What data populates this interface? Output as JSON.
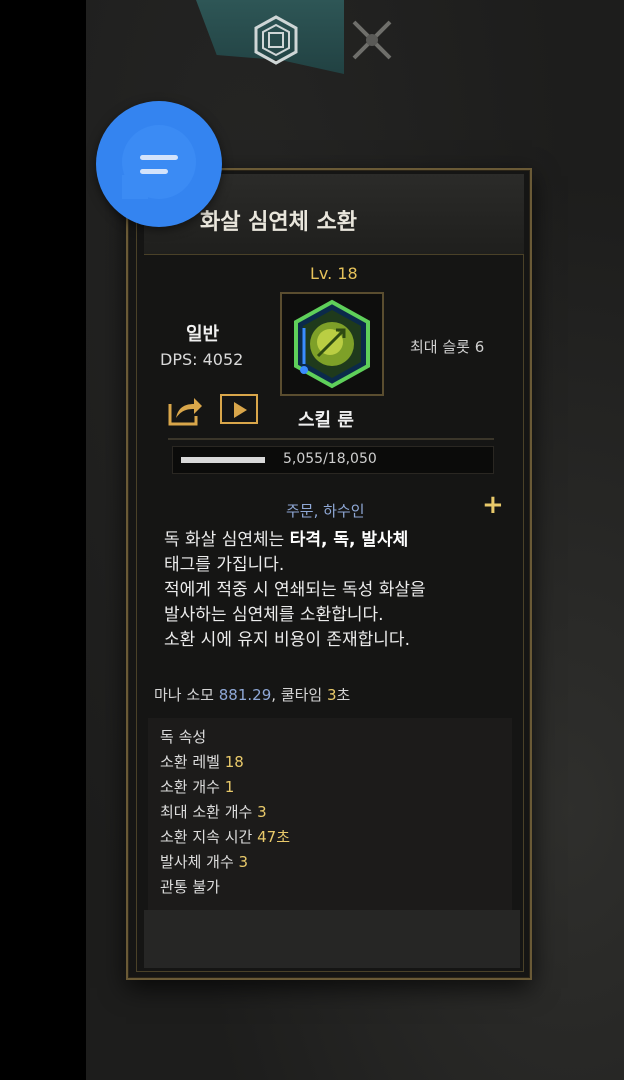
{
  "tabs": [
    {
      "icon": "rune-emblem-icon",
      "active": true
    },
    {
      "icon": "crossed-swords-icon",
      "active": false
    }
  ],
  "panel": {
    "title": "화살 심연체 소환",
    "level": "Lv. 18",
    "rarity": "일반",
    "dps": "DPS: 4052",
    "max_slot": "최대 슬롯 6",
    "gem_icon": "poison-arrow-gem-icon",
    "skill_rune": "스킬 룬",
    "xp_text": "5,055/18,050",
    "xp_progress": 0.28,
    "tags": "주문, 하수인",
    "desc_line1_prefix": "독 화살 심연체는 ",
    "desc_line1_bold": "타격, 독, 발사체",
    "desc_line2": "태그를 가집니다.",
    "desc_line3": "적에게 적중 시 연쇄되는 독성 화살을",
    "desc_line4": "발사하는 심연체를 소환합니다.",
    "desc_line5": "소환 시에 유지 비용이 존재합니다.",
    "mana_label": "마나 소모 ",
    "mana_value": "881.29",
    "cooldown_sep": ", 쿨타임 ",
    "cooldown_value": "3",
    "cooldown_unit": "초",
    "stats": [
      {
        "label": "독 속성",
        "value": ""
      },
      {
        "label": "소환 레벨 ",
        "value": "18"
      },
      {
        "label": "소환 개수 ",
        "value": "1"
      },
      {
        "label": "최대 소환 개수 ",
        "value": "3"
      },
      {
        "label": "소환 지속 시간 ",
        "value": "47초"
      },
      {
        "label": "발사체 개수 ",
        "value": "3"
      },
      {
        "label": "관통 불가",
        "value": ""
      }
    ]
  },
  "colors": {
    "gold": "#e8c96a",
    "tag_blue": "#8fa8d6",
    "chat_button": "#3484f0"
  }
}
